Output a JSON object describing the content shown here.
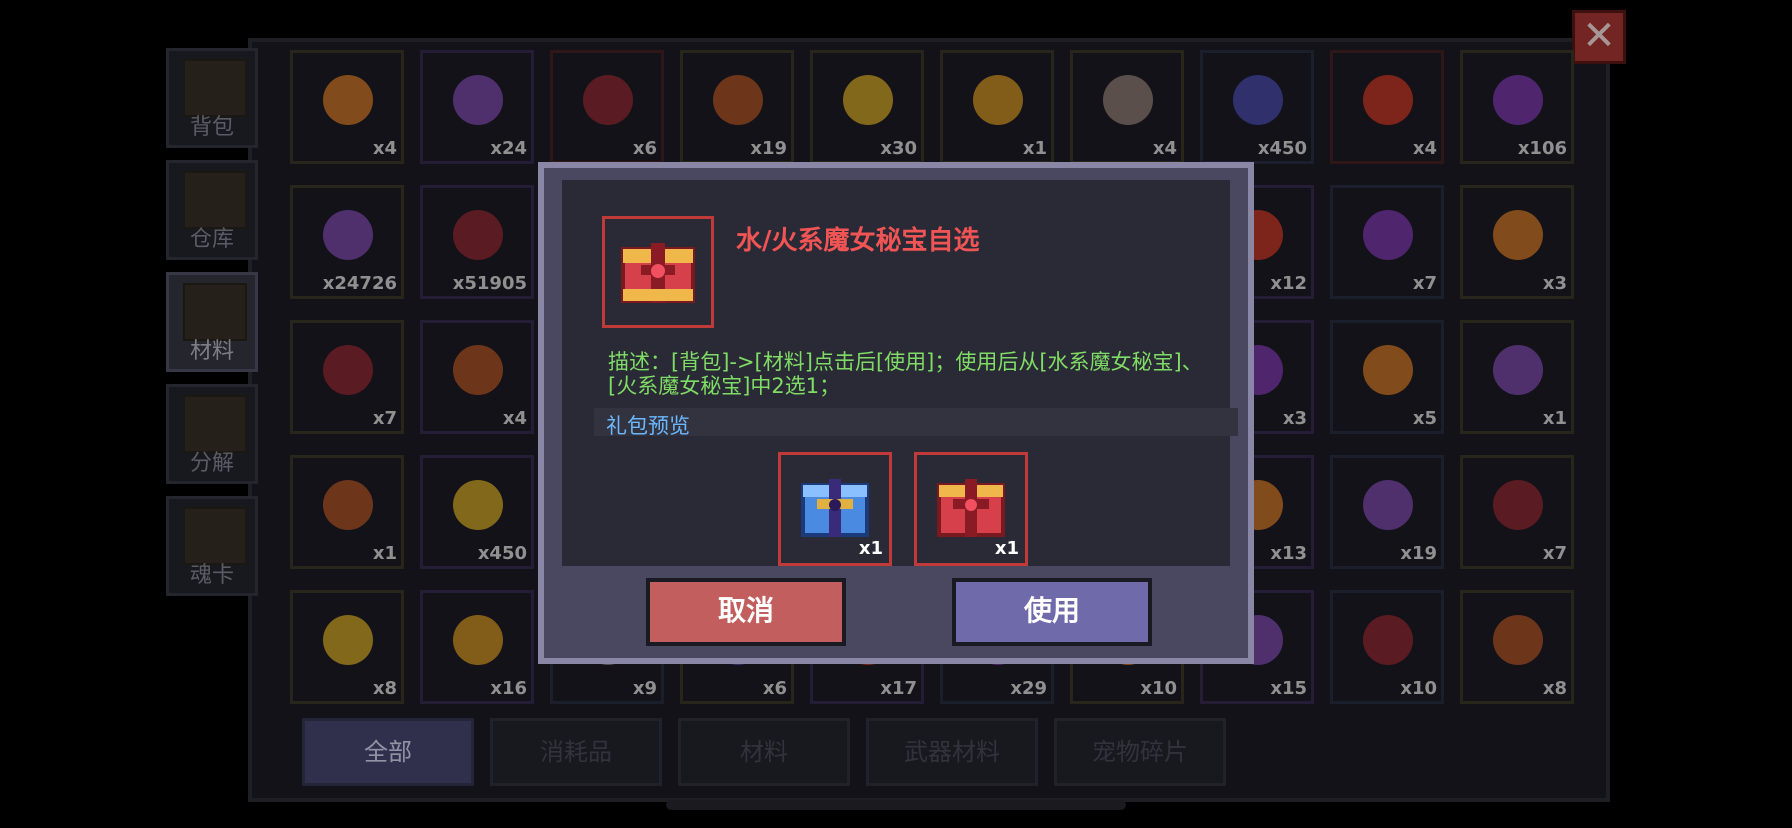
{
  "close_label": "✕",
  "side_tabs": [
    {
      "label": "背包"
    },
    {
      "label": "仓库"
    },
    {
      "label": "材料"
    },
    {
      "label": "分解"
    },
    {
      "label": "魂卡"
    }
  ],
  "grid_rows": [
    [
      "x4",
      "x24",
      "x6",
      "x19",
      "x30",
      "x1",
      "x4",
      "x450",
      "x4",
      "x106"
    ],
    [
      "x24726",
      "x51905",
      "",
      "",
      "",
      "",
      "",
      "x12",
      "x7",
      "x3"
    ],
    [
      "x7",
      "x4",
      "",
      "",
      "",
      "",
      "",
      "x3",
      "x5",
      "x1"
    ],
    [
      "x1",
      "x450",
      "",
      "",
      "",
      "",
      "",
      "x13",
      "x19",
      "x7"
    ],
    [
      "x8",
      "x16",
      "x9",
      "x6",
      "x17",
      "x29",
      "x10",
      "x15",
      "x10",
      "x8"
    ]
  ],
  "bottom_tabs": [
    {
      "label": "全部"
    },
    {
      "label": "消耗品"
    },
    {
      "label": "材料"
    },
    {
      "label": "武器材料"
    },
    {
      "label": "宠物碎片"
    }
  ],
  "dialog": {
    "title": "水/火系魔女秘宝自选",
    "description": "描述：[背包]->[材料]点击后[使用]；使用后从[水系魔女秘宝]、[火系魔女秘宝]中2选1；",
    "preview_label": "礼包预览",
    "preview_items": [
      {
        "count": "x1",
        "icon": "blue-chest-icon"
      },
      {
        "count": "x1",
        "icon": "red-chest-icon"
      }
    ],
    "cancel_label": "取消",
    "use_label": "使用"
  },
  "colors": {
    "title": "#f05454",
    "description": "#7fdc64",
    "preview": "#6ab8ff",
    "cancel": "#c25e5e",
    "use": "#6f6aaa"
  }
}
